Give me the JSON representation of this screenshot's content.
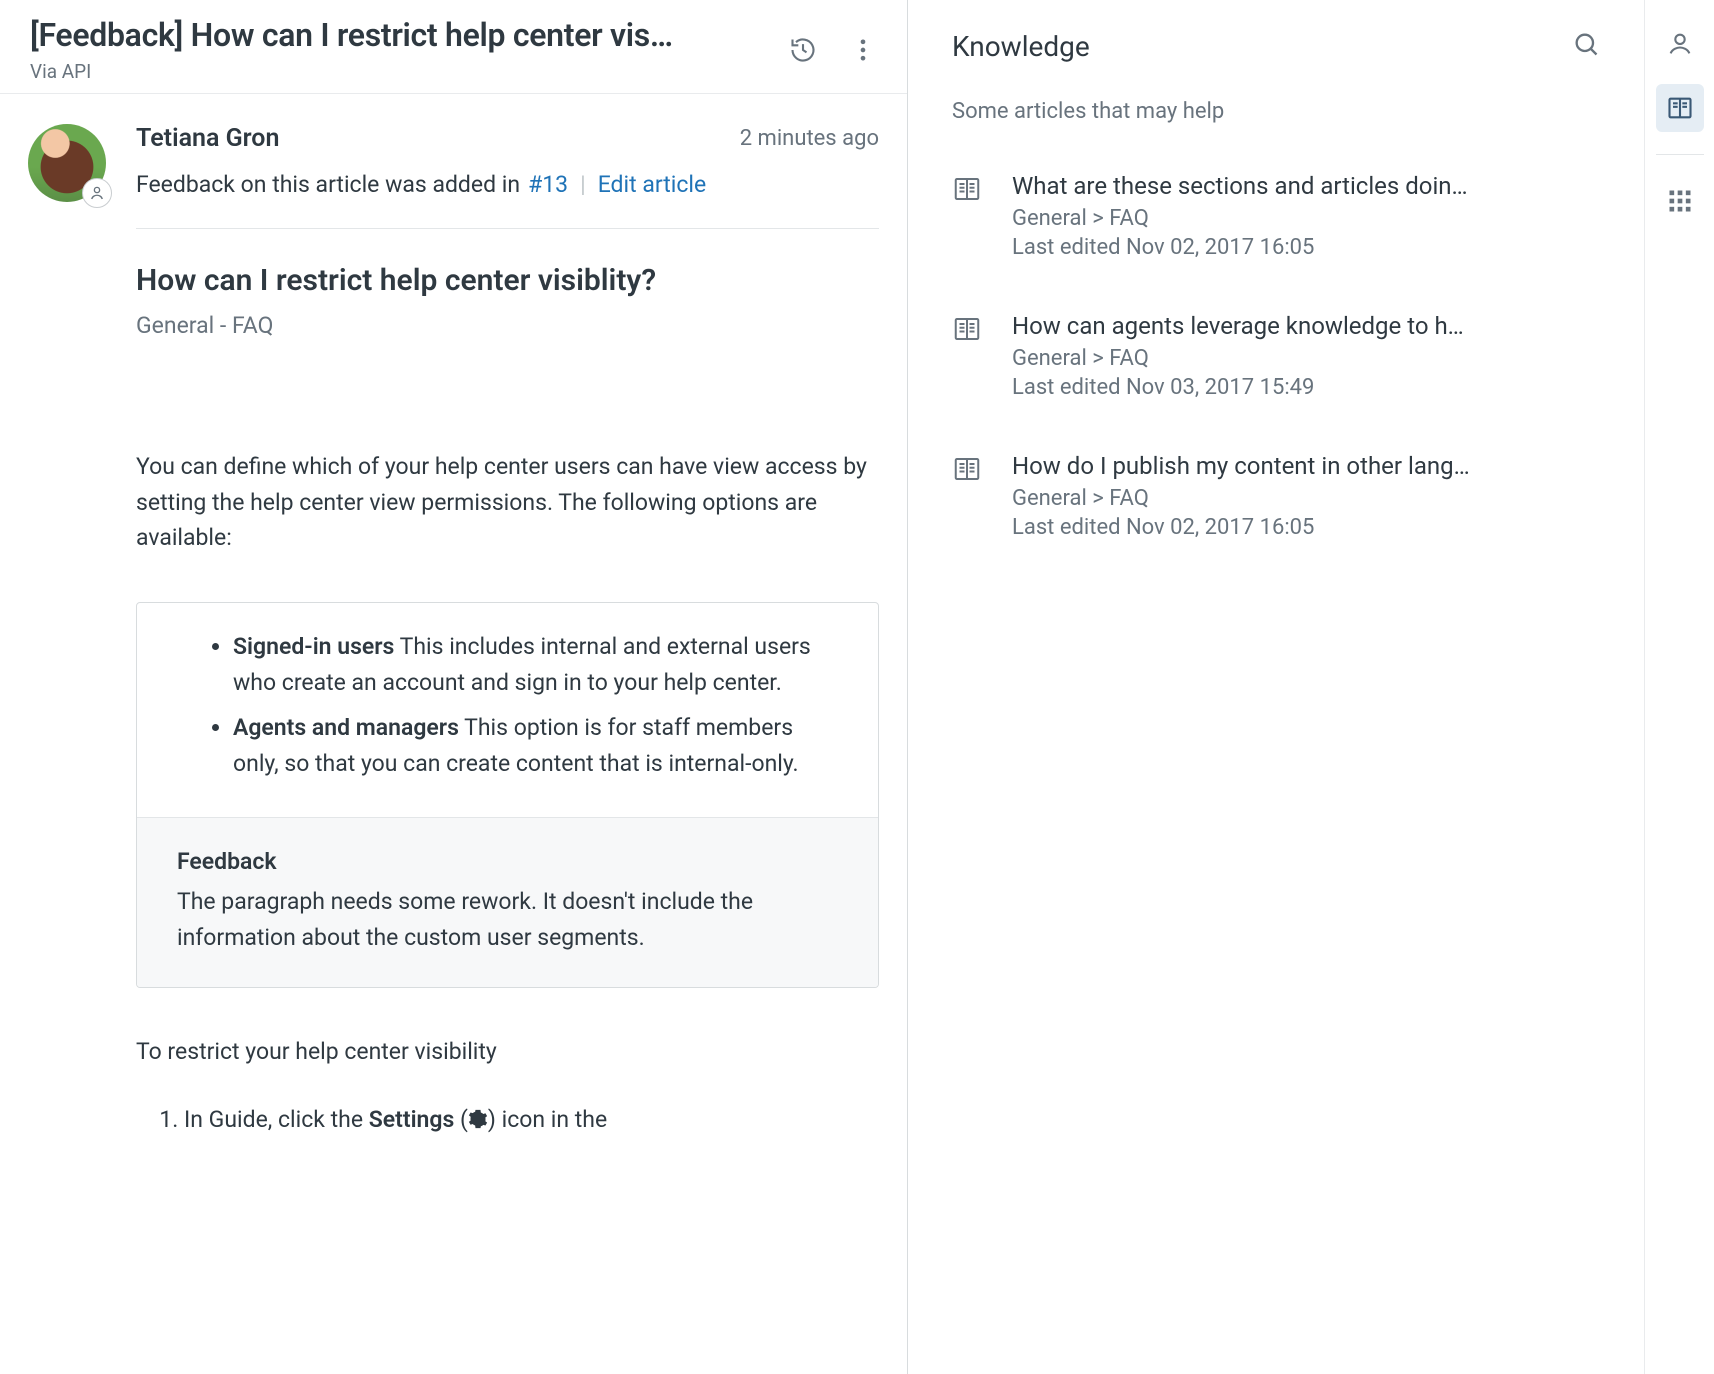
{
  "header": {
    "title": "[Feedback] How can I restrict help center vis…",
    "via": "Via API"
  },
  "post": {
    "author": "Tetiana Gron",
    "timestamp": "2 minutes ago",
    "feedback_prefix": "Feedback on this article was added in ",
    "ticket_link": "#13",
    "edit_link": "Edit article",
    "article_title": "How can I restrict help center visiblity?",
    "breadcrumb": "General - FAQ",
    "intro": "You can define which of your help center users can have view access by setting the help center view permissions. The following options are available:",
    "options": [
      {
        "term": "Signed-in users",
        "desc": " This includes internal and external users who create an account and sign in to your help center."
      },
      {
        "term": "Agents and managers",
        "desc": " This option is for staff members only, so that you can create content that is internal-only."
      }
    ],
    "feedback": {
      "heading": "Feedback",
      "body": "The paragraph needs some rework. It doesn't include the information about the custom user segments."
    },
    "outro": "To restrict your help center visibility",
    "step1_pre": "In Guide, click the ",
    "step1_bold": "Settings",
    "step1_post_a": " (",
    "step1_post_b": ") icon in the"
  },
  "knowledge": {
    "title": "Knowledge",
    "subtitle": "Some articles that may help",
    "articles": [
      {
        "title": "What are these sections and articles doin…",
        "path": "General > FAQ",
        "edited": "Last edited Nov 02, 2017 16:05"
      },
      {
        "title": "How can agents leverage knowledge to h…",
        "path": "General > FAQ",
        "edited": "Last edited Nov 03, 2017 15:49"
      },
      {
        "title": "How do I publish my content in other lang…",
        "path": "General > FAQ",
        "edited": "Last edited Nov 02, 2017 16:05"
      }
    ]
  }
}
